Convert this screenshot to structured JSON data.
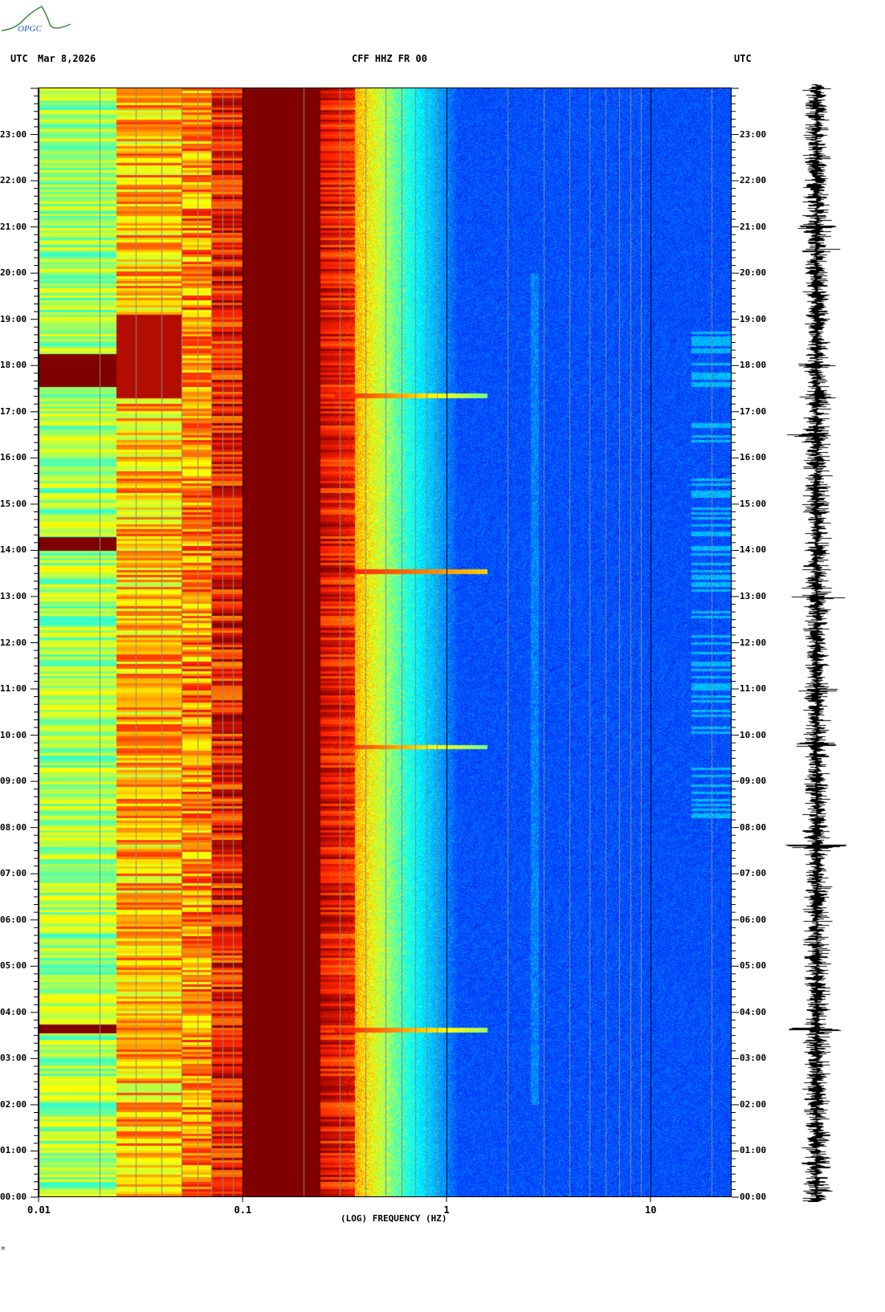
{
  "header": {
    "left_tz": "UTC",
    "date": "Mar 8,2026",
    "station": "CFF HHZ FR 00",
    "right_tz": "UTC"
  },
  "logo": {
    "text": "OPGC",
    "colors": {
      "curve": "#3a8a3a",
      "text": "#2050d0"
    }
  },
  "footer_mark": "M",
  "chart_data": {
    "type": "heatmap",
    "title": "CFF HHZ FR 00",
    "xlabel": "(LOG) FREQUENCY (HZ)",
    "ylabel": "",
    "x_scale": "log",
    "xlim": [
      0.01,
      25
    ],
    "x_ticks": [
      "0.01",
      "0.1",
      "1",
      "10"
    ],
    "ylim": [
      "00:00",
      "24:00"
    ],
    "y_ticks": [
      "00:00",
      "01:00",
      "02:00",
      "03:00",
      "04:00",
      "05:00",
      "06:00",
      "07:00",
      "08:00",
      "09:00",
      "10:00",
      "11:00",
      "12:00",
      "13:00",
      "14:00",
      "15:00",
      "16:00",
      "17:00",
      "18:00",
      "19:00",
      "20:00",
      "21:00",
      "22:00",
      "23:00"
    ],
    "colormap": [
      "#00009a",
      "#0030ff",
      "#00a0ff",
      "#00ffff",
      "#80ff80",
      "#ffff00",
      "#ff9000",
      "#ff2000",
      "#800000"
    ],
    "grid": true,
    "side_panel": "seismogram trace"
  }
}
